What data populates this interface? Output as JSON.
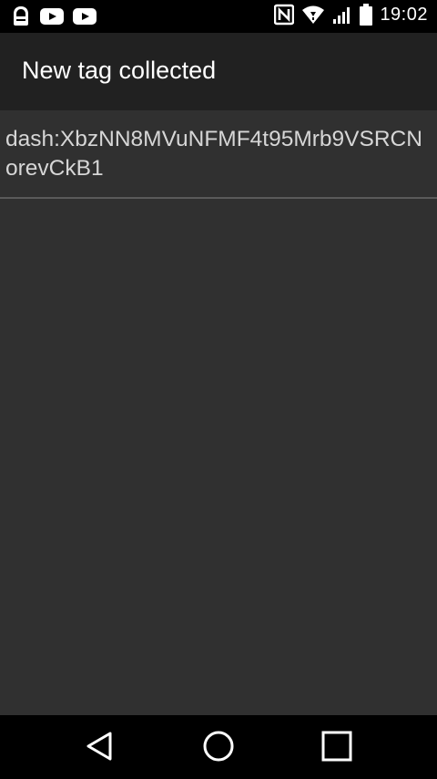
{
  "status_bar": {
    "time": "19:02",
    "left_icons": [
      "notification-app-icon",
      "youtube-icon",
      "youtube-icon"
    ],
    "right_icons": [
      "nfc-icon",
      "wifi-icon",
      "signal-icon",
      "battery-icon"
    ]
  },
  "action_bar": {
    "title": "New tag collected"
  },
  "list": {
    "items": [
      {
        "text": "dash:XbzNN8MVuNFMF4t95Mrb9VSRCNorevCkB1"
      }
    ]
  },
  "nav_bar": {
    "icons": [
      "back-icon",
      "home-icon",
      "recents-icon"
    ]
  },
  "colors": {
    "status_bar_bg": "#000000",
    "action_bar_bg": "#212121",
    "content_bg": "#303030",
    "text_primary": "#ffffff",
    "text_item": "#d6d6d6",
    "divider": "#5a5a5a"
  }
}
